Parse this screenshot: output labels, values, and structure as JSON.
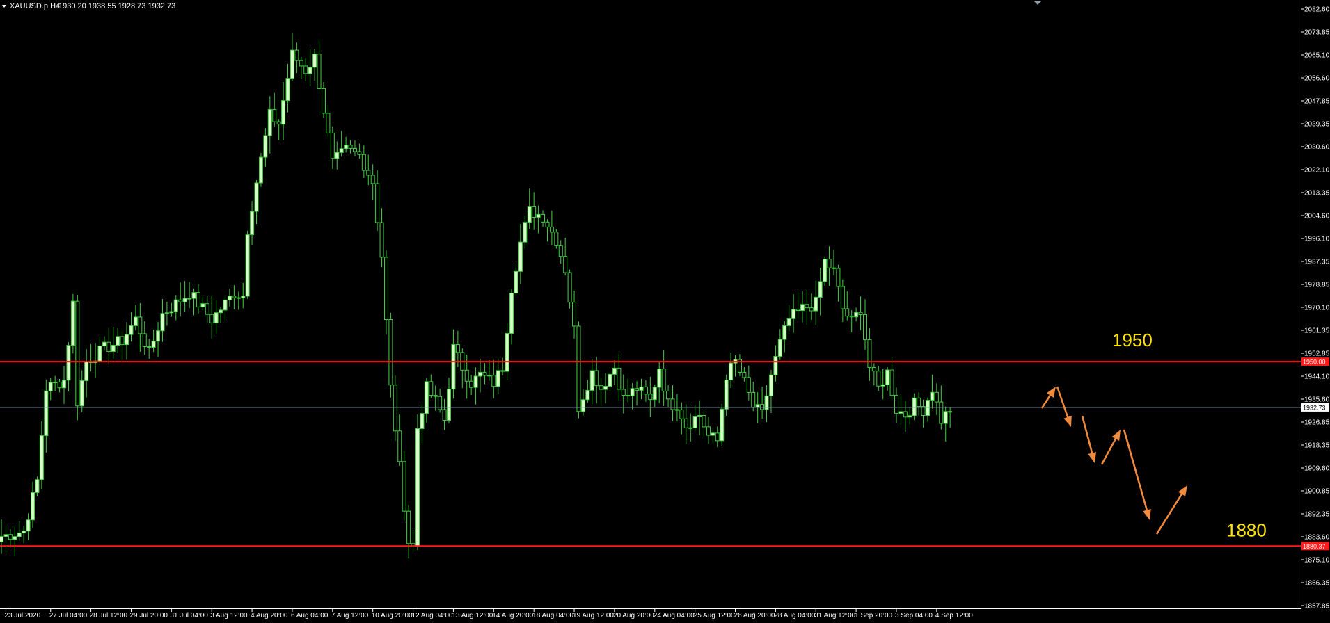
{
  "header": {
    "symbol": "XAUUSD.p,H4",
    "ohlc": "1930.20 1938.55 1928.73 1932.73"
  },
  "colors": {
    "background": "#000000",
    "up_body": "#d8ffc8",
    "down_body": "#000000",
    "candle_line": "#3fd23f",
    "level_line": "#ff1a1a",
    "bid_line": "#8a9fb0",
    "arrow": "#f08a3c",
    "level_text": "#ffe400",
    "axis": "#ffffff"
  },
  "chart_data": {
    "type": "candlestick",
    "ylim": [
      1857.85,
      2084.0
    ],
    "price_ticks": [
      "2082.60",
      "2073.85",
      "2065.10",
      "2056.60",
      "2047.85",
      "2039.35",
      "2030.60",
      "2022.10",
      "2013.35",
      "2004.60",
      "1996.10",
      "1987.35",
      "1978.85",
      "1970.10",
      "1961.35",
      "1952.85",
      "1944.10",
      "1935.60",
      "1926.85",
      "1918.35",
      "1909.60",
      "1900.85",
      "1892.35",
      "1883.60",
      "1875.10",
      "1866.35",
      "1857.85"
    ],
    "time_ticks": [
      {
        "label": "23 Jul 2020",
        "index": 1
      },
      {
        "label": "27 Jul 04:00",
        "index": 11
      },
      {
        "label": "28 Jul 12:00",
        "index": 20
      },
      {
        "label": "29 Jul 20:00",
        "index": 29
      },
      {
        "label": "31 Jul 04:00",
        "index": 38
      },
      {
        "label": "3 Aug 12:00",
        "index": 47
      },
      {
        "label": "4 Aug 20:00",
        "index": 56
      },
      {
        "label": "6 Aug 04:00",
        "index": 65
      },
      {
        "label": "7 Aug 12:00",
        "index": 74
      },
      {
        "label": "10 Aug 20:00",
        "index": 83
      },
      {
        "label": "12 Aug 04:00",
        "index": 92
      },
      {
        "label": "13 Aug 12:00",
        "index": 101
      },
      {
        "label": "14 Aug 20:00",
        "index": 110
      },
      {
        "label": "18 Aug 04:00",
        "index": 119
      },
      {
        "label": "19 Aug 12:00",
        "index": 128
      },
      {
        "label": "20 Aug 20:00",
        "index": 137
      },
      {
        "label": "24 Aug 04:00",
        "index": 146
      },
      {
        "label": "25 Aug 12:00",
        "index": 155
      },
      {
        "label": "26 Aug 20:00",
        "index": 164
      },
      {
        "label": "28 Aug 04:00",
        "index": 173
      },
      {
        "label": "31 Aug 12:00",
        "index": 182
      },
      {
        "label": "1 Sep 20:00",
        "index": 191
      },
      {
        "label": "3 Sep 04:00",
        "index": 200
      },
      {
        "label": "4 Sep 12:00",
        "index": 209
      }
    ],
    "anchors": [
      [
        0,
        1884
      ],
      [
        5,
        1886
      ],
      [
        8,
        1905
      ],
      [
        10,
        1940
      ],
      [
        14,
        1943
      ],
      [
        16,
        1972
      ],
      [
        17,
        1935
      ],
      [
        19,
        1950
      ],
      [
        23,
        1955
      ],
      [
        27,
        1958
      ],
      [
        30,
        1966
      ],
      [
        33,
        1953
      ],
      [
        36,
        1968
      ],
      [
        42,
        1976
      ],
      [
        47,
        1966
      ],
      [
        52,
        1976
      ],
      [
        54,
        1975
      ],
      [
        55,
        2000
      ],
      [
        57,
        2018
      ],
      [
        60,
        2043
      ],
      [
        62,
        2040
      ],
      [
        65,
        2066
      ],
      [
        68,
        2060
      ],
      [
        70,
        2065
      ],
      [
        72,
        2045
      ],
      [
        74,
        2025
      ],
      [
        77,
        2030
      ],
      [
        80,
        2028
      ],
      [
        83,
        2018
      ],
      [
        85,
        1990
      ],
      [
        87,
        1940
      ],
      [
        89,
        1910
      ],
      [
        91,
        1882
      ],
      [
        92,
        1880
      ],
      [
        93,
        1925
      ],
      [
        95,
        1940
      ],
      [
        97,
        1935
      ],
      [
        99,
        1928
      ],
      [
        101,
        1955
      ],
      [
        103,
        1948
      ],
      [
        105,
        1942
      ],
      [
        107,
        1945
      ],
      [
        110,
        1942
      ],
      [
        112,
        1948
      ],
      [
        114,
        1978
      ],
      [
        116,
        1995
      ],
      [
        118,
        2007
      ],
      [
        121,
        2005
      ],
      [
        124,
        1996
      ],
      [
        126,
        1985
      ],
      [
        128,
        1962
      ],
      [
        129,
        1933
      ],
      [
        132,
        1946
      ],
      [
        134,
        1940
      ],
      [
        137,
        1948
      ],
      [
        139,
        1936
      ],
      [
        142,
        1940
      ],
      [
        145,
        1935
      ],
      [
        147,
        1948
      ],
      [
        149,
        1934
      ],
      [
        151,
        1934
      ],
      [
        153,
        1926
      ],
      [
        156,
        1930
      ],
      [
        158,
        1922
      ],
      [
        160,
        1920
      ],
      [
        162,
        1945
      ],
      [
        164,
        1950
      ],
      [
        166,
        1942
      ],
      [
        168,
        1933
      ],
      [
        170,
        1930
      ],
      [
        172,
        1945
      ],
      [
        174,
        1957
      ],
      [
        176,
        1966
      ],
      [
        179,
        1970
      ],
      [
        182,
        1972
      ],
      [
        184,
        1988
      ],
      [
        186,
        1984
      ],
      [
        188,
        1970
      ],
      [
        190,
        1965
      ],
      [
        192,
        1970
      ],
      [
        194,
        1948
      ],
      [
        196,
        1940
      ],
      [
        198,
        1946
      ],
      [
        200,
        1932
      ],
      [
        202,
        1930
      ],
      [
        204,
        1934
      ],
      [
        206,
        1932
      ],
      [
        208,
        1940
      ],
      [
        210,
        1928
      ],
      [
        212,
        1932
      ]
    ],
    "levels": [
      {
        "label": "1950",
        "price": 1950.0,
        "badge": "1950.00"
      },
      {
        "label": "1880",
        "price": 1880.37,
        "badge": "1880.37"
      }
    ],
    "bid": {
      "price": 1932.73,
      "badge": "1932.73"
    },
    "arrows": [
      [
        [
          1497,
          587
        ],
        [
          1517,
          556
        ]
      ],
      [
        [
          1519,
          556
        ],
        [
          1539,
          614
        ]
      ],
      [
        [
          1555,
          598
        ],
        [
          1573,
          666
        ]
      ],
      [
        [
          1583,
          668
        ],
        [
          1610,
          618
        ]
      ],
      [
        [
          1615,
          618
        ],
        [
          1652,
          748
        ]
      ],
      [
        [
          1662,
          768
        ],
        [
          1706,
          698
        ]
      ]
    ]
  }
}
